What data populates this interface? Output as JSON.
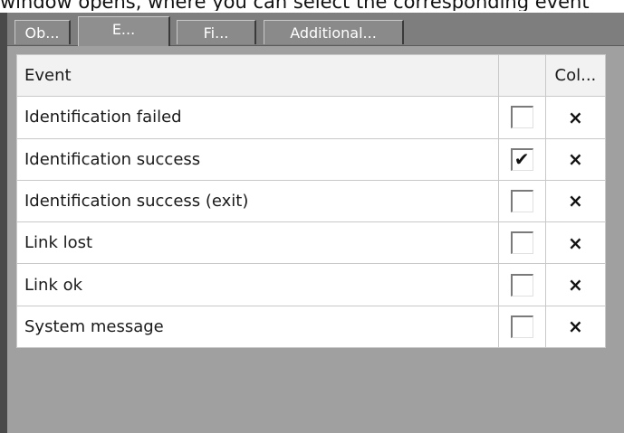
{
  "caption": "window opens, where you can select the corresponding event",
  "tabs": [
    {
      "label": "Ob...",
      "active": false
    },
    {
      "label": "E...",
      "active": true
    },
    {
      "label": "Fi...",
      "active": false
    },
    {
      "label": "Additional...",
      "active": false
    }
  ],
  "table": {
    "header": {
      "event": "Event",
      "check": "",
      "col": "Col..."
    },
    "rows": [
      {
        "event": "Identification failed",
        "checked": false,
        "col_symbol": "×"
      },
      {
        "event": "Identification success",
        "checked": true,
        "col_symbol": "×"
      },
      {
        "event": "Identification success (exit)",
        "checked": false,
        "col_symbol": "×"
      },
      {
        "event": "Link lost",
        "checked": false,
        "col_symbol": "×"
      },
      {
        "event": "Link ok",
        "checked": false,
        "col_symbol": "×"
      },
      {
        "event": "System message",
        "checked": false,
        "col_symbol": "×"
      }
    ]
  },
  "icons": {
    "check": "check-icon",
    "close": "close-icon"
  }
}
